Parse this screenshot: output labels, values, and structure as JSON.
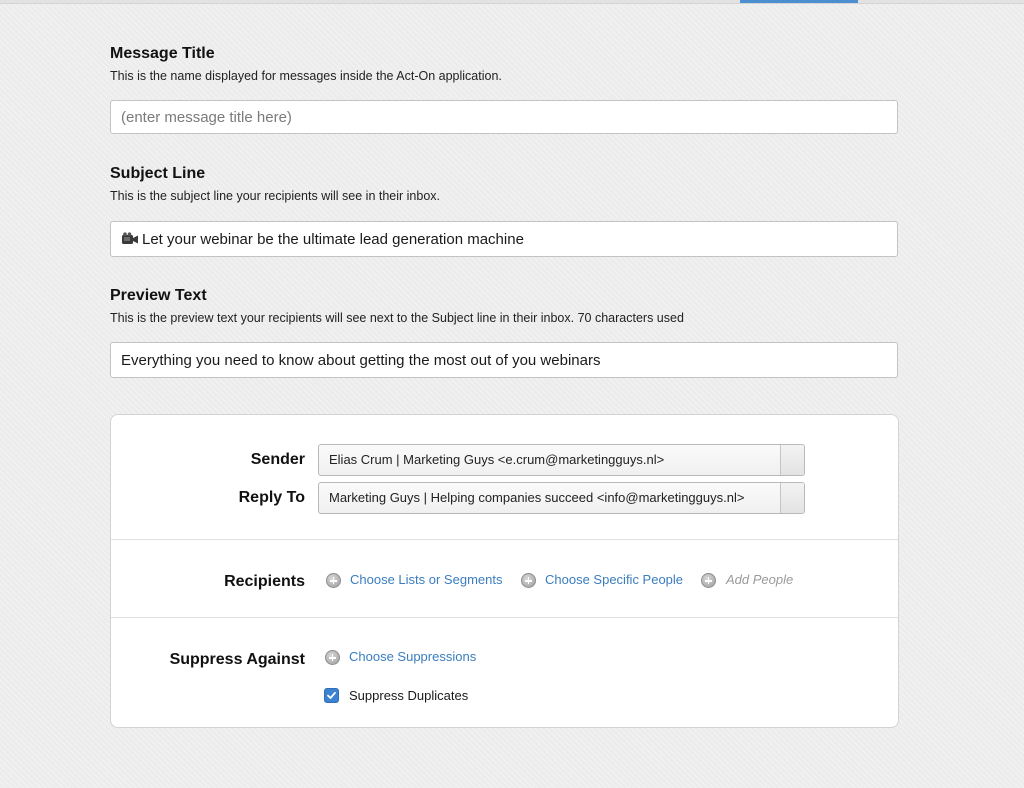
{
  "message_title": {
    "title": "Message Title",
    "description": "This is the name displayed for messages inside the Act-On application.",
    "placeholder": "(enter message title here)",
    "value": ""
  },
  "subject_line": {
    "title": "Subject Line",
    "description": "This is the subject line your recipients will see in their inbox.",
    "icon": "video-camera-icon",
    "value": "Let your webinar be the ultimate lead generation machine"
  },
  "preview_text": {
    "title": "Preview Text",
    "description": "This is the preview text your recipients will see next to the Subject line in their inbox. 70 characters used",
    "value": "Everything you need to know about getting the most out of you webinars"
  },
  "sender": {
    "label": "Sender",
    "selected": "Elias Crum | Marketing Guys <e.crum@marketingguys.nl>"
  },
  "reply_to": {
    "label": "Reply To",
    "selected": "Marketing Guys | Helping companies succeed <info@marketingguys.nl>"
  },
  "recipients": {
    "label": "Recipients",
    "actions": [
      {
        "label": "Choose Lists or Segments",
        "enabled": true
      },
      {
        "label": "Choose Specific People",
        "enabled": true
      },
      {
        "label": "Add People",
        "enabled": false
      }
    ]
  },
  "suppress": {
    "label": "Suppress Against",
    "action": "Choose Suppressions",
    "duplicates_label": "Suppress Duplicates",
    "duplicates_checked": true
  },
  "colors": {
    "link": "#3a7dbf",
    "accent": "#3b82d0",
    "disabled": "#9a9a9a"
  }
}
